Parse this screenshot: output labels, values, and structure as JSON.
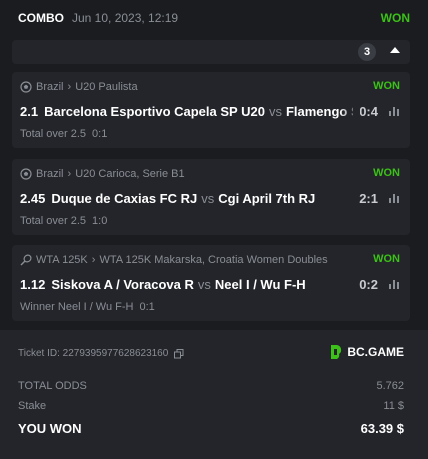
{
  "header": {
    "title": "COMBO",
    "datetime": "Jun 10, 2023, 12:19",
    "status": "WON"
  },
  "collapse": {
    "count": "3"
  },
  "bets": [
    {
      "sport_icon": "soccer-ball-icon",
      "country": "Brazil",
      "league": "U20 Paulista",
      "status": "WON",
      "odds": "2.1",
      "home": "Barcelona Esportivo Capela SP U20",
      "vs": "vs",
      "away": "Flamengo SP",
      "score": "0:4",
      "market": "Total over 2.5",
      "market_value": "0:1"
    },
    {
      "sport_icon": "soccer-ball-icon",
      "country": "Brazil",
      "league": "U20 Carioca, Serie B1",
      "status": "WON",
      "odds": "2.45",
      "home": "Duque de Caxias FC RJ",
      "vs": "vs",
      "away": "Cgi April 7th RJ",
      "score": "2:1",
      "market": "Total over 2.5",
      "market_value": "1:0"
    },
    {
      "sport_icon": "tennis-racket-icon",
      "country": "WTA 125K",
      "league": "WTA 125K Makarska, Croatia Women Doubles",
      "status": "WON",
      "odds": "1.12",
      "home": "Siskova A / Voracova R",
      "vs": "vs",
      "away": "Neel I / Wu F-H",
      "score": "0:2",
      "market": "Winner Neel I / Wu F-H",
      "market_value": "0:1"
    }
  ],
  "footer": {
    "ticket_label": "Ticket ID:",
    "ticket_id": "2279395977628623160",
    "brand": "BC.GAME",
    "total_odds_label": "TOTAL ODDS",
    "total_odds": "5.762",
    "stake_label": "Stake",
    "stake": "11 $",
    "won_label": "YOU WON",
    "won": "63.39 $"
  },
  "colors": {
    "background": "#1a1c20",
    "card": "#23252a",
    "accent_green": "#3bc117",
    "muted": "#8a8e95"
  }
}
